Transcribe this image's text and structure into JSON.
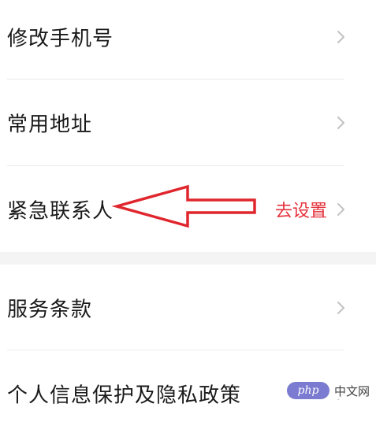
{
  "settings": {
    "items": [
      {
        "label": "修改手机号",
        "value": ""
      },
      {
        "label": "常用地址",
        "value": ""
      },
      {
        "label": "紧急联系人",
        "value": "去设置"
      },
      {
        "label": "服务条款",
        "value": ""
      },
      {
        "label": "个人信息保护及隐私政策",
        "value": ""
      }
    ]
  },
  "colors": {
    "accent": "#e5323c",
    "annotation": "#e0262d",
    "text": "#1a1a1a",
    "chevron": "#c2c2c2",
    "divider": "#ebebeb",
    "section_gap": "#f4f4f4"
  },
  "icons": {
    "chevron": "chevron-right-icon",
    "annotation": "arrow-left-icon"
  },
  "watermark": {
    "logo": "php",
    "text": "中文网"
  }
}
